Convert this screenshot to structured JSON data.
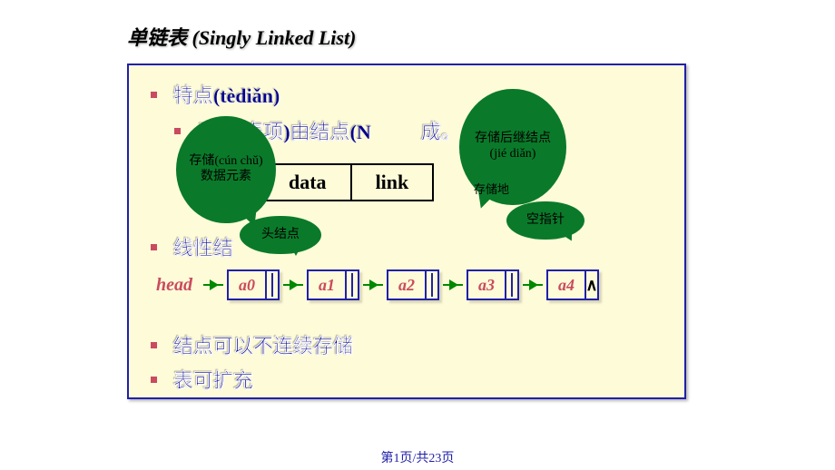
{
  "title": "单链表 (Singly Linked List)",
  "bullets": {
    "b1": "特点(tèdiǎn)",
    "b2": "元素(表项)由结点(N          成。",
    "b3": "线性结",
    "b4": "结点可以不连续存储",
    "b5": "表可扩充"
  },
  "node_table": {
    "c1": "data",
    "c2": "link"
  },
  "callouts": {
    "store_elem": "存储(cún chǔ)数据元素",
    "succ_node": "存储后继结点(jié diǎn)",
    "head_node": "头结点",
    "null_ptr": "空指针",
    "store_addr": "存储地"
  },
  "list": {
    "head": "head",
    "nodes": [
      "a0",
      "a1",
      "a2",
      "a3",
      "a4"
    ],
    "null": "∧"
  },
  "footer": "第1页/共23页"
}
